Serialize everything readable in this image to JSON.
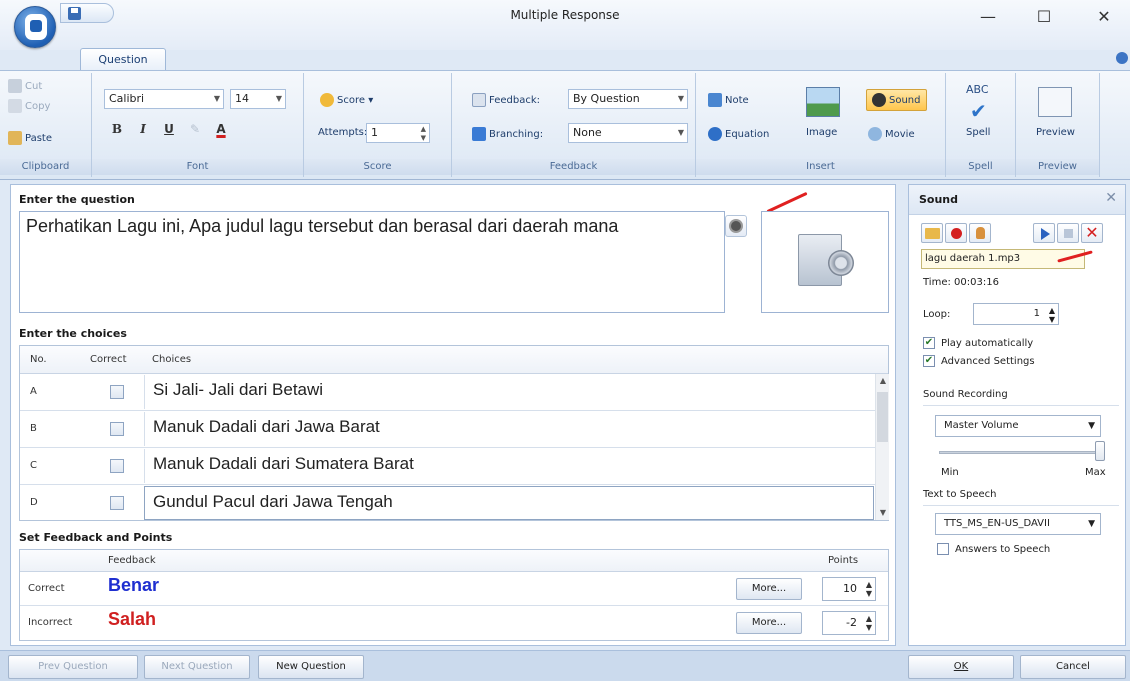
{
  "window": {
    "title": "Multiple Response",
    "minimize": "—",
    "maximize": "☐",
    "close": "✕"
  },
  "tabs": [
    {
      "label": "Question"
    }
  ],
  "ribbon": {
    "clipboard": {
      "label": "Clipboard",
      "cut": "Cut",
      "copy": "Copy",
      "paste": "Paste"
    },
    "font": {
      "label": "Font",
      "family": "Calibri",
      "size": "14",
      "bold": "B",
      "italic": "I",
      "underline": "U",
      "color": "A"
    },
    "score": {
      "label": "Score",
      "score_btn": "Score",
      "attempts_label": "Attempts:",
      "attempts_value": "1"
    },
    "feedback": {
      "label": "Feedback",
      "feedback_label": "Feedback:",
      "feedback_value": "By Question",
      "branching_label": "Branching:",
      "branching_value": "None"
    },
    "insert": {
      "label": "Insert",
      "note": "Note",
      "equation": "Equation",
      "image": "Image",
      "sound": "Sound",
      "movie": "Movie"
    },
    "spell": {
      "label": "Spell",
      "spell_btn": "Spell",
      "icon_text": "ABC"
    },
    "preview": {
      "label": "Preview",
      "preview_btn": "Preview"
    }
  },
  "question": {
    "section_title": "Enter the question",
    "text": "Perhatikan Lagu ini, Apa judul lagu tersebut dan berasal dari daerah mana"
  },
  "choices": {
    "section_title": "Enter the choices",
    "headers": {
      "no": "No.",
      "correct": "Correct",
      "choices": "Choices"
    },
    "rows": [
      {
        "no": "A",
        "text": "Si Jali- Jali dari Betawi",
        "correct": false
      },
      {
        "no": "B",
        "text": "Manuk Dadali dari Jawa Barat",
        "correct": false
      },
      {
        "no": "C",
        "text": "Manuk Dadali dari Sumatera Barat",
        "correct": false
      },
      {
        "no": "D",
        "text": "Gundul Pacul dari Jawa Tengah",
        "correct": false
      }
    ]
  },
  "feedback_points": {
    "section_title": "Set Feedback and Points",
    "headers": {
      "feedback": "Feedback",
      "points": "Points"
    },
    "rows": [
      {
        "label": "Correct",
        "text": "Benar",
        "color": "#1f2fd0",
        "more": "More...",
        "points": "10"
      },
      {
        "label": "Incorrect",
        "text": "Salah",
        "color": "#d02020",
        "more": "More...",
        "points": "-2"
      }
    ]
  },
  "sound_panel": {
    "title": "Sound",
    "close": "✕",
    "file": "lagu daerah 1.mp3",
    "time_label": "Time:",
    "time_value": "00:03:16",
    "loop_label": "Loop:",
    "loop_value": "1",
    "play_auto": {
      "label": "Play automatically",
      "checked": true
    },
    "advanced": {
      "label": "Advanced Settings",
      "checked": true
    },
    "recording_label": "Sound Recording",
    "recording_value": "Master Volume",
    "slider_min": "Min",
    "slider_max": "Max",
    "volume_level": 1.0,
    "tts_label": "Text to Speech",
    "tts_value": "TTS_MS_EN-US_DAVII",
    "answers_to_speech": {
      "label": "Answers to Speech",
      "checked": false
    }
  },
  "footer": {
    "prev": "Prev Question",
    "next": "Next Question",
    "new": "New Question",
    "ok": "OK",
    "cancel": "Cancel"
  },
  "colors": {
    "accent": "#1f5fb3",
    "correct_text": "#1f2fd0",
    "incorrect_text": "#d02020",
    "marker": "#e02020"
  }
}
